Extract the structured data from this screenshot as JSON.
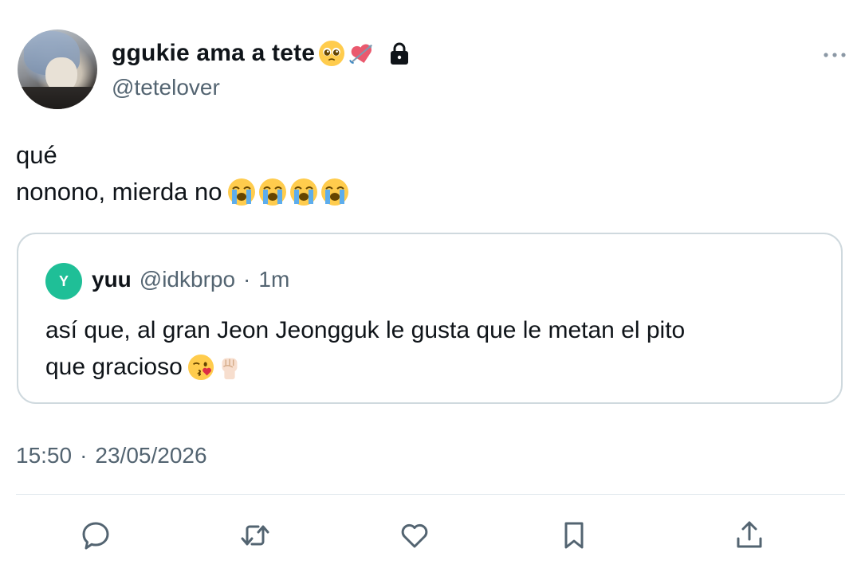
{
  "author": {
    "display_name": "ggukie ama a tete",
    "handle": "@tetelover",
    "name_emojis": [
      "pleading-face-emoji",
      "heart-with-arrow-emoji"
    ],
    "protected_icon": "lock-icon"
  },
  "tweet": {
    "lines": [
      "qué",
      "nonono, mierda no"
    ],
    "line2_emojis": [
      "loudly-crying-face-emoji",
      "loudly-crying-face-emoji",
      "loudly-crying-face-emoji",
      "loudly-crying-face-emoji"
    ]
  },
  "quote": {
    "avatar_letter": "Y",
    "name": "yuu",
    "handle": "@idkbrpo",
    "separator": "·",
    "time": "1m",
    "lines": [
      "así que, al gran Jeon Jeongguk le gusta que le metan el pito",
      "que gracioso"
    ],
    "line2_emojis": [
      "face-blowing-kiss-emoji",
      "raised-fist-emoji"
    ]
  },
  "meta": {
    "time": "15:50",
    "separator": "·",
    "date": "23/05/2026"
  },
  "actions": [
    "reply-icon",
    "retweet-icon",
    "like-icon",
    "bookmark-icon",
    "share-icon"
  ],
  "colors": {
    "text_primary": "#0f1419",
    "text_secondary": "#536471",
    "border": "#cfd9de",
    "quote_avatar": "#1fbf97"
  }
}
